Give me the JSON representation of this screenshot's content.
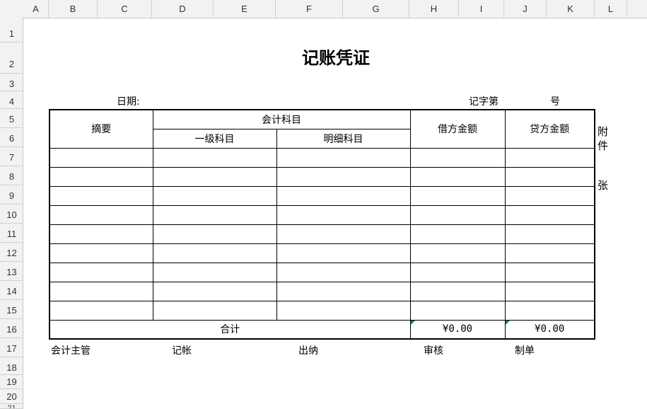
{
  "columns": [
    "A",
    "B",
    "C",
    "D",
    "E",
    "F",
    "G",
    "H",
    "I",
    "J",
    "K",
    "L"
  ],
  "rows": [
    "1",
    "2",
    "3",
    "4",
    "5",
    "6",
    "7",
    "8",
    "9",
    "10",
    "11",
    "12",
    "13",
    "14",
    "15",
    "16",
    "17",
    "18",
    "19",
    "20",
    "21"
  ],
  "voucher": {
    "title": "记账凭证",
    "date_label": "日期:",
    "record_label": "记字第",
    "number_label": "号",
    "headers": {
      "summary": "摘要",
      "account": "会计科目",
      "first_level": "一级科目",
      "detail": "明细科目",
      "debit": "借方金额",
      "credit": "贷方金额"
    },
    "blank_rows": 9,
    "total_label": "合计",
    "total_debit": "¥0.00",
    "total_credit": "¥0.00",
    "attachment_chars": [
      "附",
      "件",
      "张"
    ]
  },
  "signatures": {
    "supervisor": "会计主管",
    "bookkeeping": "记帐",
    "cashier": "出纳",
    "review": "审核",
    "preparer": "制单"
  }
}
